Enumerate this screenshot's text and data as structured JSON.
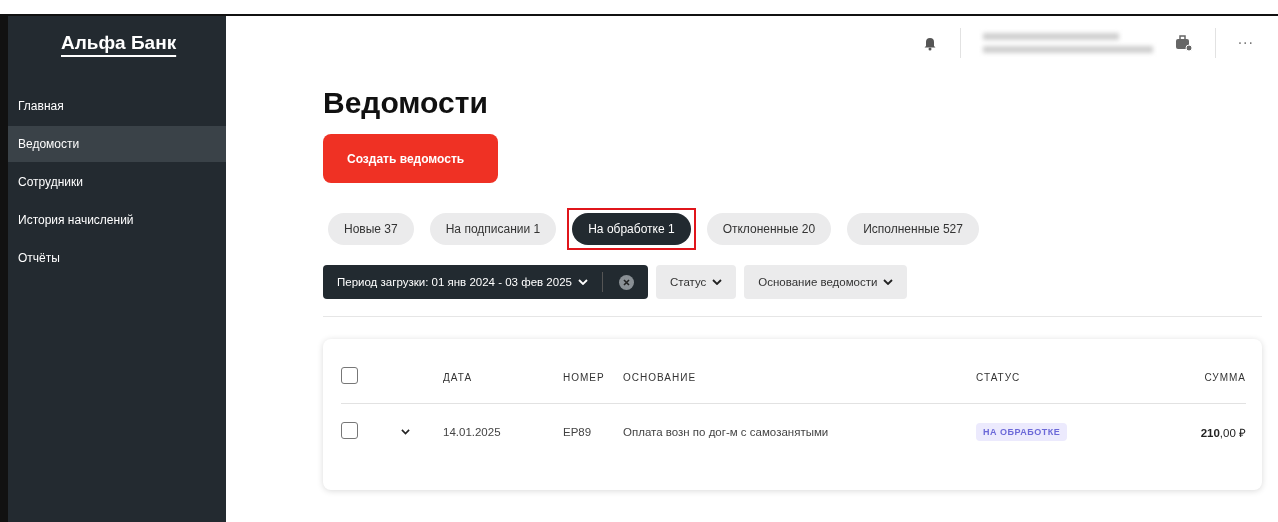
{
  "sidebar": {
    "logo": "Альфа Банк",
    "items": [
      {
        "label": "Главная",
        "selected": false
      },
      {
        "label": "Ведомости",
        "selected": true
      },
      {
        "label": "Сотрудники",
        "selected": false
      },
      {
        "label": "История начислений",
        "selected": false
      },
      {
        "label": "Отчёты",
        "selected": false
      }
    ]
  },
  "header": {
    "more": "···"
  },
  "title": "Ведомости",
  "create_button": "Создать ведомость",
  "tabs": [
    {
      "label": "Новые 37",
      "selected": false,
      "highlighted": false
    },
    {
      "label": "На подписании 1",
      "selected": false,
      "highlighted": false
    },
    {
      "label": "На обработке 1",
      "selected": true,
      "highlighted": true
    },
    {
      "label": "Отклоненные 20",
      "selected": false,
      "highlighted": false
    },
    {
      "label": "Исполненные 527",
      "selected": false,
      "highlighted": false
    }
  ],
  "filters": [
    {
      "label": "Период загрузки: 01 янв 2024 - 03 фев 2025",
      "active": true
    },
    {
      "label": "Статус",
      "active": false
    },
    {
      "label": "Основание ведомости",
      "active": false
    }
  ],
  "table": {
    "columns": [
      "ДАТА",
      "НОМЕР",
      "ОСНОВАНИЕ",
      "СТАТУС",
      "СУММА"
    ],
    "header_checked": false,
    "rows": [
      {
        "checked": false,
        "date": "14.01.2025",
        "number": "EP89",
        "basis": "Оплата возн по дог-м с самозанятыми",
        "status": "НА ОБРАБОТКЕ",
        "amount": "**210**,00 ₽"
      }
    ]
  }
}
